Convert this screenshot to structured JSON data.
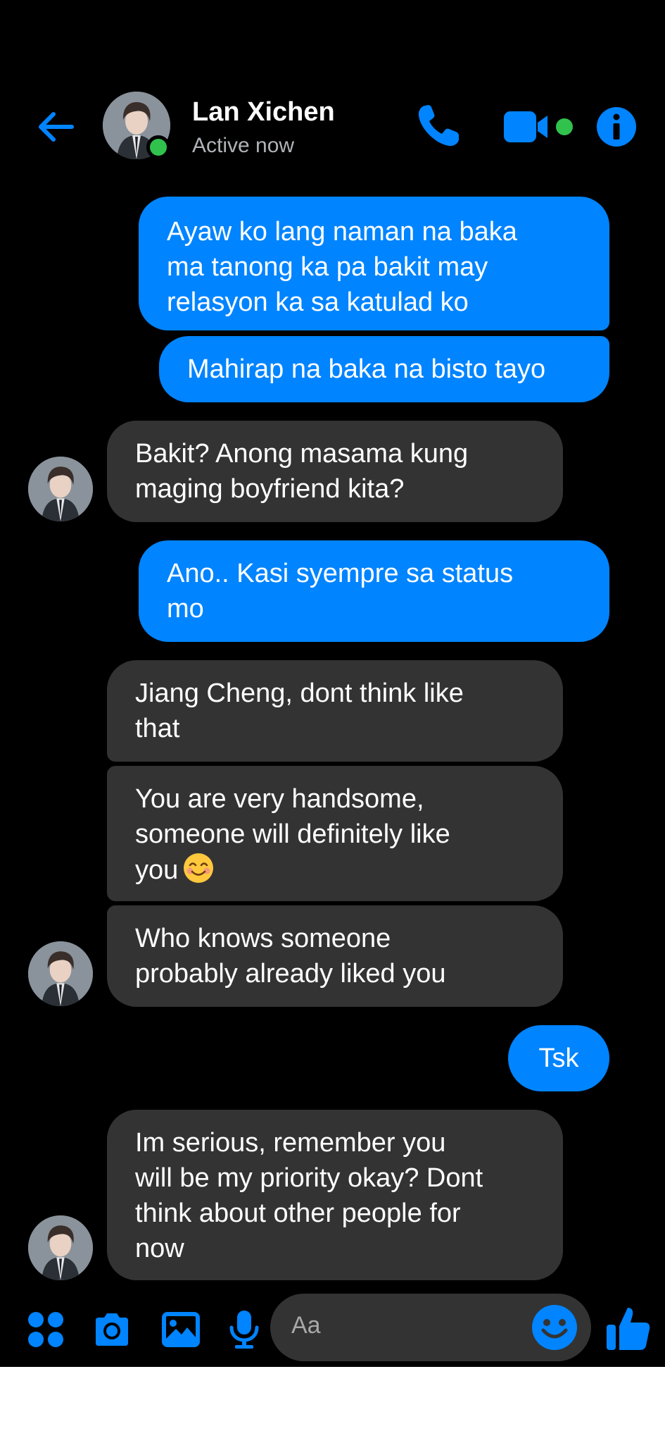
{
  "header": {
    "contact_name": "Lan Xichen",
    "status": "Active now"
  },
  "messages": [
    {
      "from": "me",
      "lines": [
        "Ayaw ko lang naman na baka",
        "ma tanong ka pa bakit may",
        "relasyon ka sa katulad ko"
      ]
    },
    {
      "from": "me",
      "lines": [
        "Mahirap na baka na bisto tayo"
      ]
    },
    {
      "from": "them",
      "lines": [
        "Bakit? Anong masama kung",
        "maging boyfriend kita?"
      ]
    },
    {
      "from": "me",
      "lines": [
        "Ano.. Kasi syempre sa status",
        "mo"
      ]
    },
    {
      "from": "them",
      "lines": [
        "Jiang Cheng, dont think like",
        "that"
      ]
    },
    {
      "from": "them",
      "lines": [
        "You are very handsome,",
        "someone will definitely like",
        "you"
      ],
      "emoji": "smiling-face-icon"
    },
    {
      "from": "them",
      "lines": [
        "Who knows someone",
        "probably already liked you"
      ]
    },
    {
      "from": "me",
      "lines": [
        "Tsk"
      ]
    },
    {
      "from": "them",
      "lines": [
        "Im serious, remember you",
        "will be my priority okay? Dont",
        "think about other people for",
        "now"
      ]
    }
  ],
  "composer": {
    "placeholder": "Aa",
    "icons": [
      "menu-dots-icon",
      "camera-icon",
      "gallery-icon",
      "microphone-icon",
      "emoji-icon",
      "thumbs-up-icon"
    ]
  },
  "colors": {
    "accent": "#0084ff",
    "sent_bubble": "#0084ff",
    "received_bubble": "#333333",
    "background": "#000000",
    "online": "#31c24d",
    "status_text": "#b0b3b8"
  }
}
